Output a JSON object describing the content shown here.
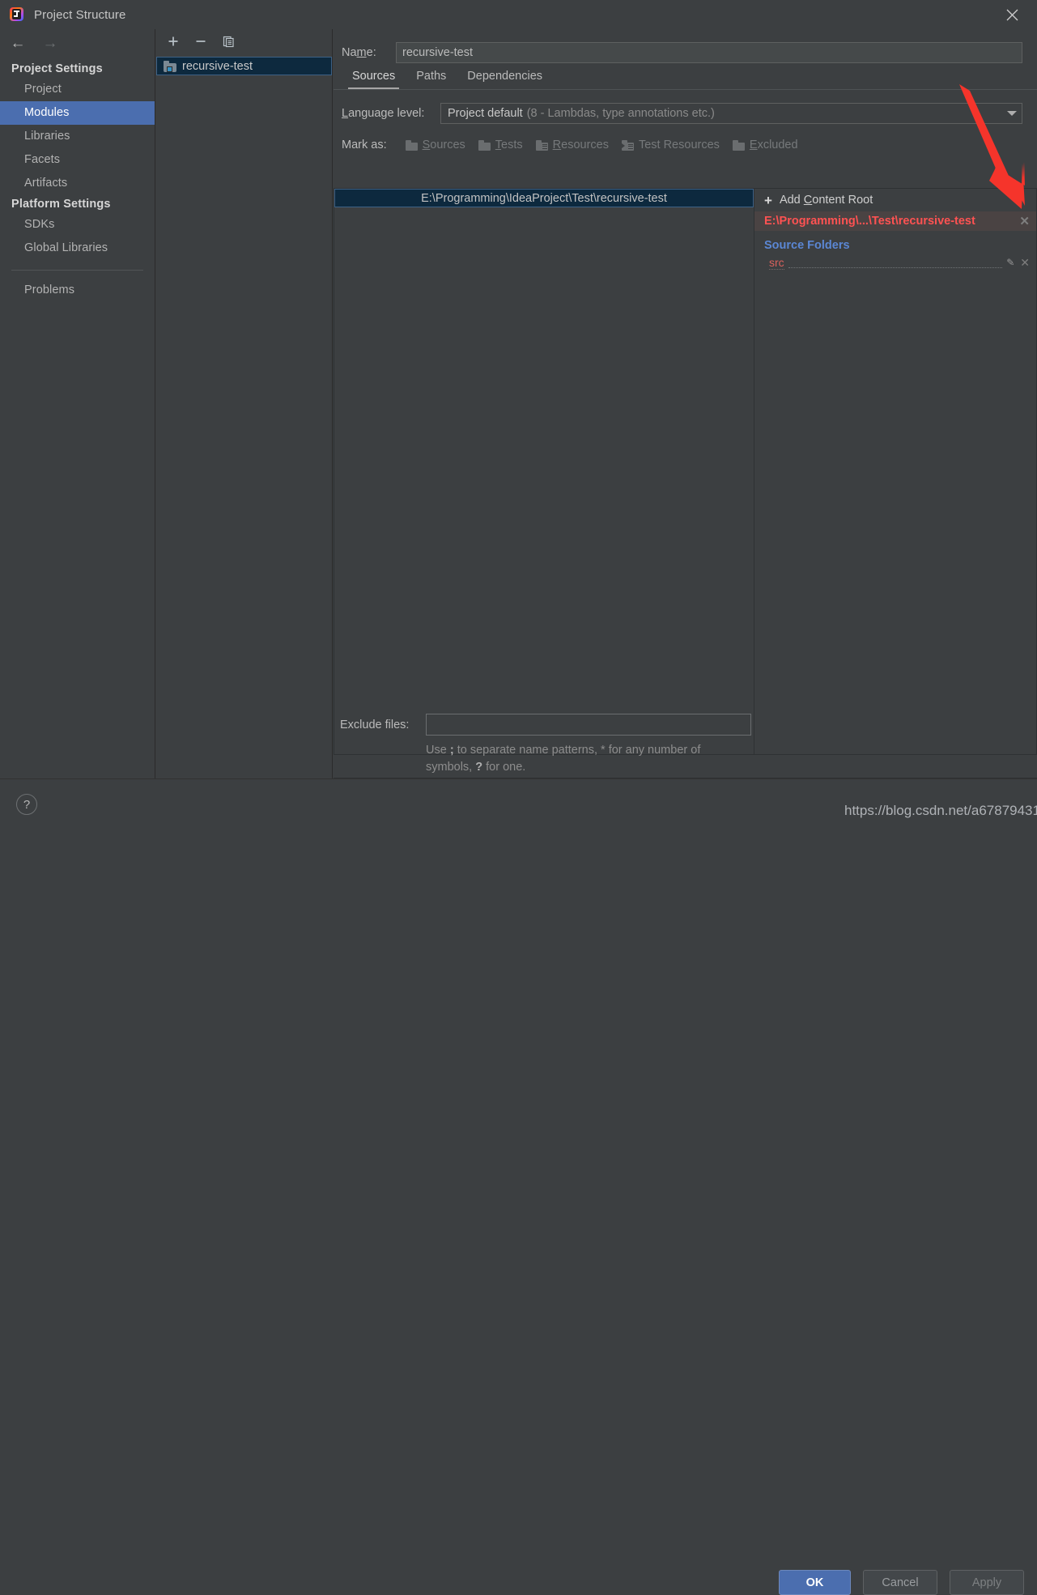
{
  "window": {
    "title": "Project Structure",
    "app_icon": "intellij-idea-icon",
    "close_icon": "close-icon"
  },
  "sidebar": {
    "back_icon": "back-arrow-icon",
    "forward_icon": "forward-arrow-icon",
    "groups": [
      {
        "label": "Project Settings",
        "items": [
          {
            "label": "Project",
            "selected": false
          },
          {
            "label": "Modules",
            "selected": true
          },
          {
            "label": "Libraries",
            "selected": false
          },
          {
            "label": "Facets",
            "selected": false
          },
          {
            "label": "Artifacts",
            "selected": false
          }
        ]
      },
      {
        "label": "Platform Settings",
        "items": [
          {
            "label": "SDKs",
            "selected": false
          },
          {
            "label": "Global Libraries",
            "selected": false
          }
        ]
      }
    ],
    "problems_label": "Problems"
  },
  "modules_panel": {
    "toolbar": {
      "add_icon": "plus-icon",
      "remove_icon": "minus-icon",
      "copy_icon": "copy-icon"
    },
    "modules": [
      {
        "name": "recursive-test",
        "icon": "module-folder-icon",
        "selected": true
      }
    ]
  },
  "main": {
    "name_label": "Name:",
    "name_mnemonic": "m",
    "name_value": "recursive-test",
    "tabs": [
      {
        "label": "Sources",
        "active": true
      },
      {
        "label": "Paths",
        "active": false
      },
      {
        "label": "Dependencies",
        "active": false
      }
    ],
    "language_level": {
      "label": "Language level:",
      "mnemonic": "L",
      "value_primary": "Project default",
      "value_secondary": "(8 - Lambdas, type annotations etc.)",
      "caret_icon": "chevron-down-icon"
    },
    "mark_as": {
      "label": "Mark as:",
      "options": [
        {
          "label": "Sources",
          "mnemonic": "S",
          "icon": "folder-sources-icon"
        },
        {
          "label": "Tests",
          "mnemonic": "T",
          "icon": "folder-tests-icon"
        },
        {
          "label": "Resources",
          "mnemonic": "R",
          "icon": "folder-resources-icon"
        },
        {
          "label": "Test Resources",
          "mnemonic": "",
          "icon": "folder-test-resources-icon"
        },
        {
          "label": "Excluded",
          "mnemonic": "E",
          "icon": "folder-excluded-icon"
        }
      ]
    },
    "content_root_tree": {
      "selected_path": "E:\\Programming\\IdeaProject\\Test\\recursive-test"
    },
    "content_roots_panel": {
      "add_content_root_label": "Add Content Root",
      "add_content_root_mnemonic": "C",
      "add_icon": "plus-icon",
      "selected_root": {
        "path": "E:\\Programming\\...\\Test\\recursive-test",
        "remove_icon": "close-icon",
        "error": true
      },
      "source_folders_title": "Source Folders",
      "source_folders": [
        {
          "name": "src",
          "edit_icon": "pencil-icon",
          "remove_icon": "close-icon",
          "error": true
        }
      ]
    },
    "exclude": {
      "label": "Exclude files:",
      "value": "",
      "hint_part1": "Use ",
      "hint_semicolon": ";",
      "hint_part2": " to separate name patterns, * for any number of symbols, ",
      "hint_question": "?",
      "hint_part3": " for one."
    }
  },
  "footer": {
    "help_icon": "help-icon",
    "help_label": "?",
    "buttons": [
      {
        "label": "OK",
        "kind": "primary"
      },
      {
        "label": "Cancel",
        "kind": "default"
      },
      {
        "label": "Apply",
        "kind": "disabled"
      }
    ]
  },
  "annotations": {
    "watermark": "https://blog.csdn.net/a67879431",
    "arrow_color": "#f5342b",
    "arrow_name": "red-pointer-arrow"
  },
  "colors": {
    "background": "#3c3f41",
    "selection_blue": "#4b6eaf",
    "tree_selection": "#0d293e",
    "error_red": "#ff5252",
    "link_blue": "#5b87d4"
  }
}
